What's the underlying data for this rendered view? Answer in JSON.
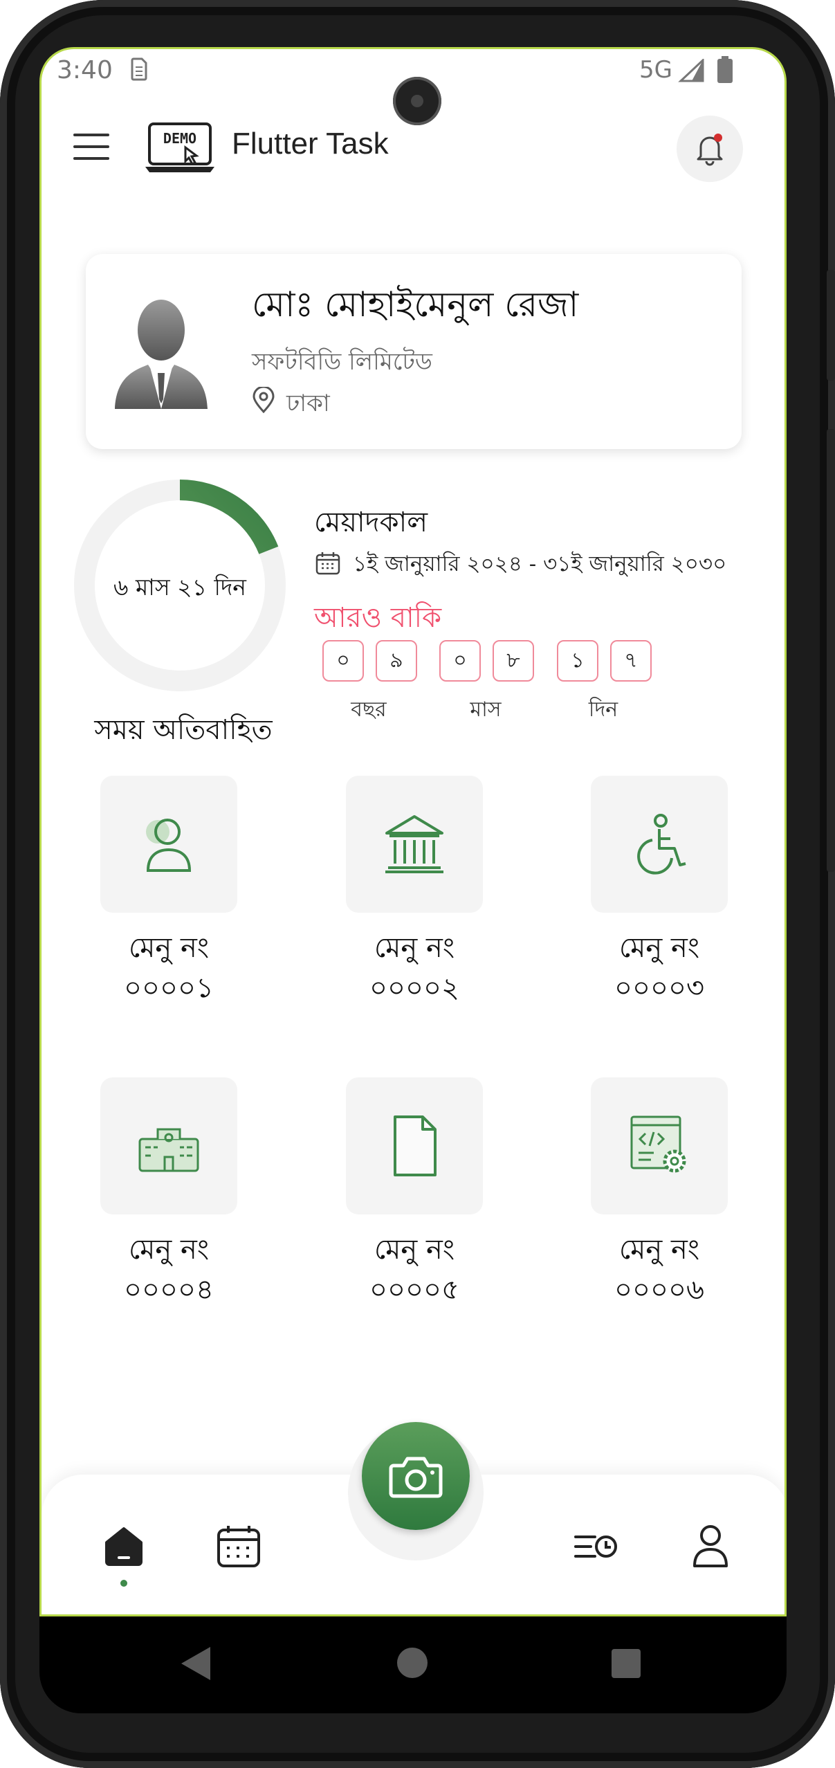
{
  "status_bar": {
    "time": "3:40",
    "network": "5G"
  },
  "app_bar": {
    "logo_text": "DEMO",
    "title": "Flutter Task"
  },
  "profile": {
    "name": "মোঃ মোহাইমেনুল রেজা",
    "company": "সফটবিডি লিমিটেড",
    "location": "ঢাকা"
  },
  "duration": {
    "elapsed_text": "৬ মাস ২১ দিন",
    "elapsed_caption": "সময় অতিবাহিত",
    "elapsed_fraction": 0.19,
    "tenure_title": "মেয়াদকাল",
    "tenure_range": "১ই জানুয়ারি ২০২৪ - ৩১ই জানুয়ারি ২০৩০",
    "remaining_title": "আরও বাকি",
    "digits": [
      "০",
      "৯",
      "০",
      "৮",
      "১",
      "৭"
    ],
    "units": [
      "বছর",
      "মাস",
      "দিন"
    ]
  },
  "menu": [
    {
      "label": "মেনু নং",
      "number": "০০০০১",
      "icon": "person-icon"
    },
    {
      "label": "মেনু নং",
      "number": "০০০০২",
      "icon": "bank-icon"
    },
    {
      "label": "মেনু নং",
      "number": "০০০০৩",
      "icon": "wheelchair-icon"
    },
    {
      "label": "মেনু নং",
      "number": "০০০০৪",
      "icon": "school-building-icon"
    },
    {
      "label": "মেনু নং",
      "number": "০০০০৫",
      "icon": "document-icon"
    },
    {
      "label": "মেনু নং",
      "number": "০০০০৬",
      "icon": "code-settings-icon"
    }
  ],
  "bottom_nav": {
    "items": [
      "home-icon",
      "calendar-icon",
      "camera-icon",
      "history-icon",
      "profile-icon"
    ],
    "active": "home-icon"
  },
  "colors": {
    "accent_green": "#3f8a4b",
    "remaining_red": "#f0506e",
    "notification_dot": "#d32f2f"
  }
}
